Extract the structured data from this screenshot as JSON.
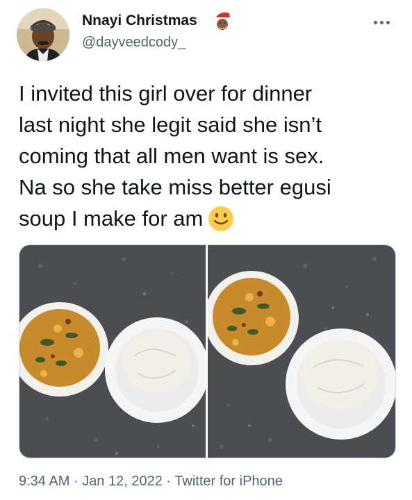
{
  "tweet": {
    "author": {
      "name": "Nnayi Christmas",
      "handle": "@dayveedcody_",
      "name_emoji": "santa-claus-icon"
    },
    "text_lines": [
      "I invited this girl over for dinner",
      "last night she legit said she isn’t",
      "coming that all men want is sex.",
      "Na so she take miss better egusi",
      "soup I make for am"
    ],
    "text_emoji": "slightly-smiling-face-icon",
    "media": [
      {
        "name": "egusi-soup-and-pounded-yam-photo-1"
      },
      {
        "name": "egusi-soup-and-pounded-yam-photo-2"
      }
    ],
    "time": "9:34 AM",
    "separator": "·",
    "date": "Jan 12, 2022",
    "source": "Twitter for iPhone"
  },
  "colors": {
    "text": "#0f1419",
    "secondary": "#536471",
    "border": "#cfd9de"
  }
}
